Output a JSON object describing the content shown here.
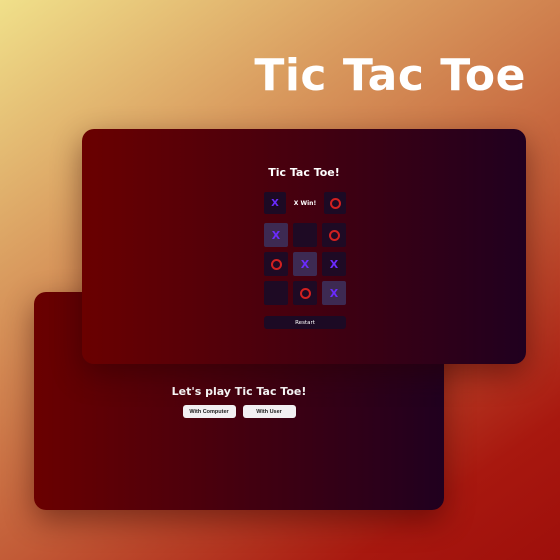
{
  "hero": {
    "title": "Tic Tac Toe"
  },
  "menu": {
    "title": "Let's play Tic Tac Toe!",
    "buttons": [
      {
        "label": "With Computer"
      },
      {
        "label": "With User"
      }
    ]
  },
  "game": {
    "title": "Tic Tac Toe!",
    "status": {
      "left_mark": "X",
      "message": "X Win!",
      "right_mark": "O"
    },
    "board": [
      {
        "mark": "X",
        "highlight": true
      },
      {
        "mark": "",
        "highlight": false
      },
      {
        "mark": "O",
        "highlight": false
      },
      {
        "mark": "O",
        "highlight": false
      },
      {
        "mark": "X",
        "highlight": true
      },
      {
        "mark": "X",
        "highlight": false
      },
      {
        "mark": "",
        "highlight": false
      },
      {
        "mark": "O",
        "highlight": false
      },
      {
        "mark": "X",
        "highlight": true
      }
    ],
    "restart_label": "Restart"
  },
  "colors": {
    "x_mark": "#6b2bff",
    "o_mark": "#d12020",
    "card_start": "#6a0000",
    "card_end": "#20001f"
  }
}
